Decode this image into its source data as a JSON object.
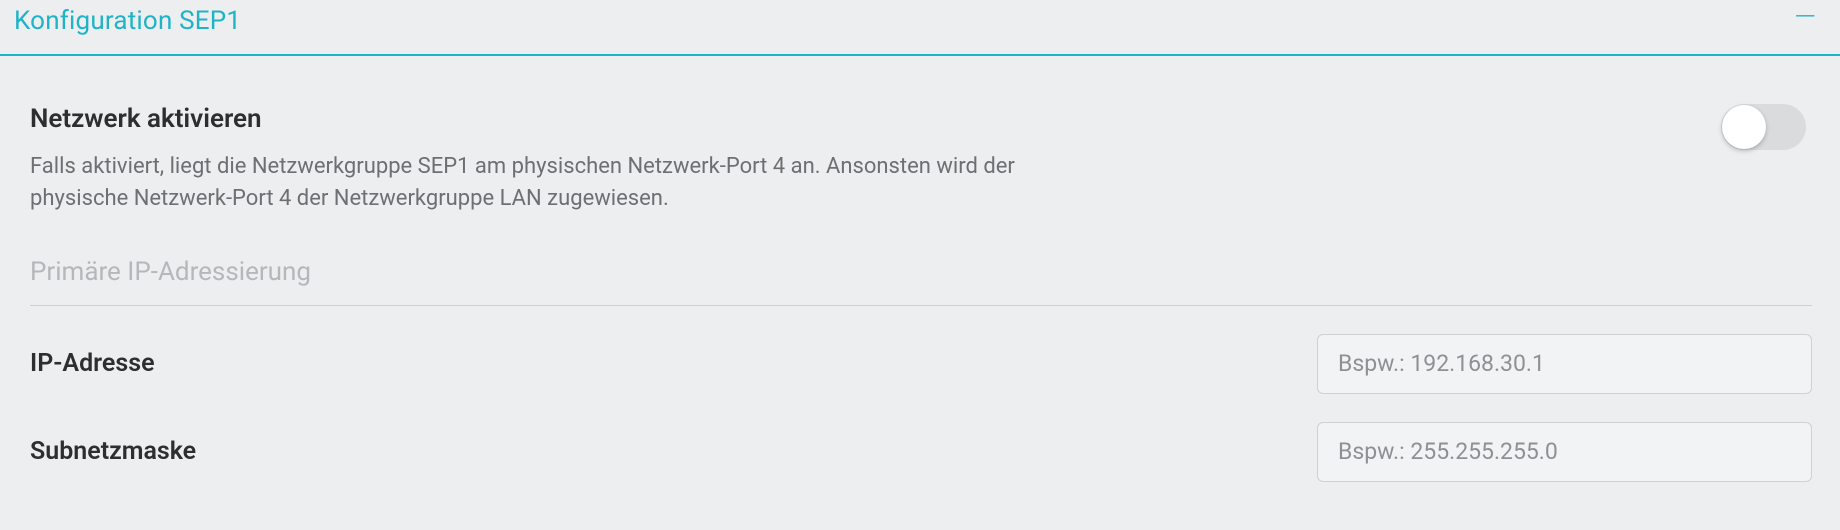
{
  "panel": {
    "title": "Konfiguration SEP1"
  },
  "activate": {
    "label": "Netzwerk aktivieren",
    "description": "Falls aktiviert, liegt die Netzwerkgruppe SEP1 am physischen Netzwerk-Port 4 an. Ansonsten wird der physische Netzwerk-Port 4 der Netzwerkgruppe LAN zugewiesen."
  },
  "primary": {
    "heading": "Primäre IP-Adressierung",
    "ip": {
      "label": "IP-Adresse",
      "placeholder": "Bspw.: 192.168.30.1",
      "value": ""
    },
    "mask": {
      "label": "Subnetzmaske",
      "placeholder": "Bspw.: 255.255.255.0",
      "value": ""
    }
  }
}
